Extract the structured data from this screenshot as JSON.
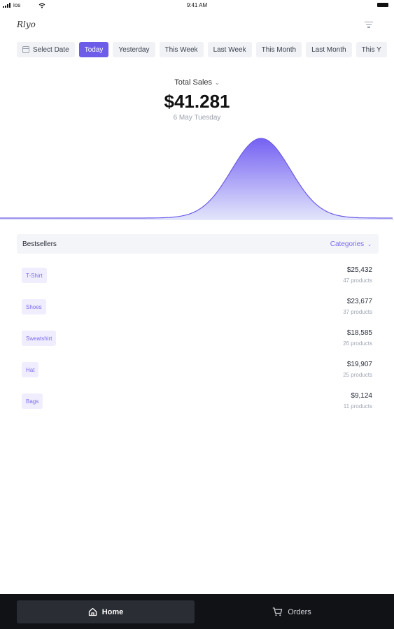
{
  "status_bar": {
    "carrier": "ios",
    "time": "9:41 AM"
  },
  "header": {
    "logo_text": "Rlyo"
  },
  "date_filters": [
    {
      "label": "Select Date",
      "icon": "calendar-icon",
      "active": false
    },
    {
      "label": "Today",
      "active": true
    },
    {
      "label": "Yesterday",
      "active": false
    },
    {
      "label": "This Week",
      "active": false
    },
    {
      "label": "Last Week",
      "active": false
    },
    {
      "label": "This Month",
      "active": false
    },
    {
      "label": "Last Month",
      "active": false
    },
    {
      "label": "This Y",
      "active": false
    }
  ],
  "sales": {
    "label": "Total Sales",
    "value": "$41.281",
    "date": "6 May Tuesday"
  },
  "chart_data": {
    "type": "area",
    "shape": "bell curve",
    "peak_position": "center-right",
    "color": "#6c5ce7"
  },
  "bestsellers": {
    "title": "Bestsellers",
    "categories_label": "Categories",
    "items": [
      {
        "name": "T-Shirt",
        "amount": "$25,432",
        "count": "47 products"
      },
      {
        "name": "Shoes",
        "amount": "$23,677",
        "count": "37 products"
      },
      {
        "name": "Sweatshirt",
        "amount": "$18,585",
        "count": "26 products"
      },
      {
        "name": "Hat",
        "amount": "$19,907",
        "count": "25 products"
      },
      {
        "name": "Bags",
        "amount": "$9,124",
        "count": "11 products"
      }
    ]
  },
  "bottom_nav": {
    "home_label": "Home",
    "orders_label": "Orders"
  },
  "colors": {
    "accent": "#6c5ce7",
    "nav_background": "#111216"
  }
}
